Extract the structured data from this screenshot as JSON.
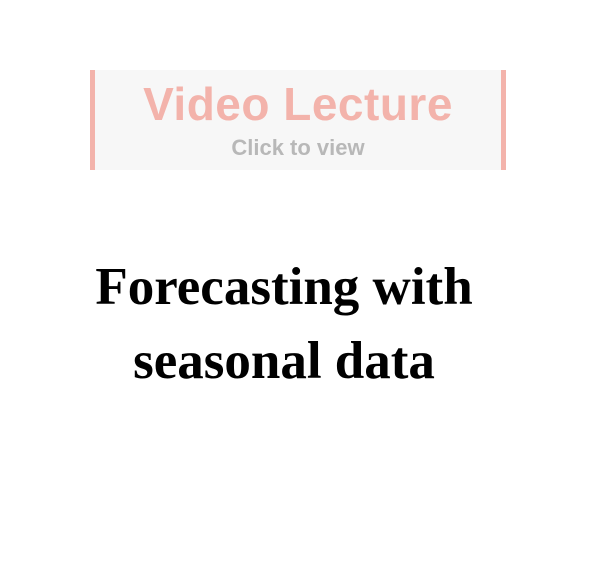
{
  "video_banner": {
    "title": "Video Lecture",
    "subtitle": "Click to view"
  },
  "lecture": {
    "title_line_1": "Forecasting with",
    "title_line_2": "seasonal data"
  },
  "colors": {
    "banner_accent": "#f3b3ab",
    "banner_subtitle": "#b8b8b8",
    "banner_background": "#f7f7f7",
    "title_text": "#000000"
  }
}
